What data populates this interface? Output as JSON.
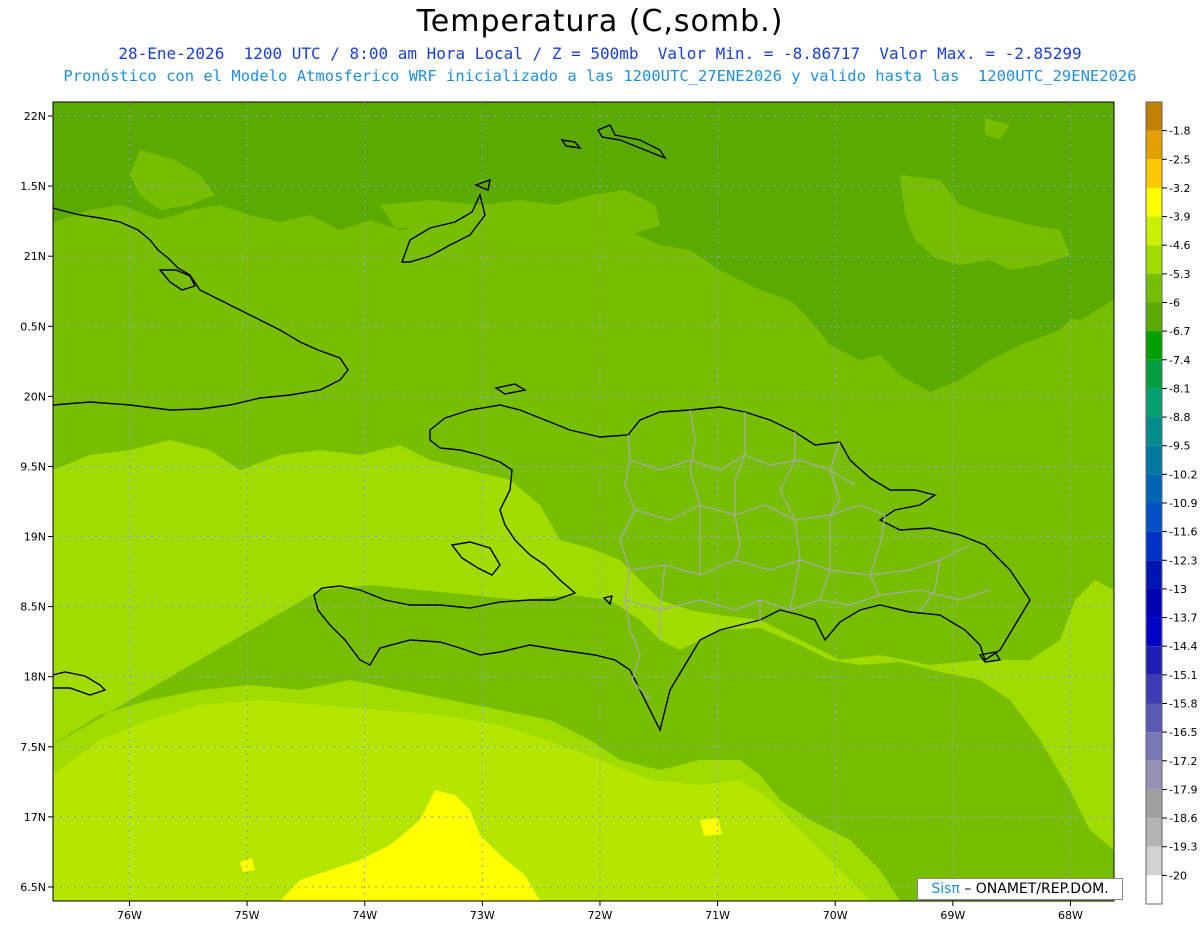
{
  "header": {
    "title": "Temperatura (C,somb.)",
    "line1": "28-Ene-2026  1200 UTC / 8:00 am Hora Local / Z = 500mb  Valor Min. = -8.86717  Valor Max. = -2.85299",
    "line2": "Pronóstico con el Modelo Atmosferico WRF inicializado a las 1200UTC_27ENE2026 y valido hasta las  1200UTC_29ENE2026"
  },
  "map": {
    "variable": "Temperatura",
    "units": "C",
    "level": "500mb",
    "valid_date": "28-Ene-2026",
    "valid_time": "1200 UTC",
    "local_time": "8:00 am Hora Local",
    "min_value": -8.86717,
    "max_value": -2.85299,
    "model": "WRF",
    "init": "1200UTC_27ENE2026",
    "valid_until": "1200UTC_29ENE2026",
    "extent": {
      "lon_min": -76.65,
      "lon_max": -67.63,
      "lat_min": 16.4,
      "lat_max": 22.1
    },
    "lat_labels": [
      "22N",
      "1.5N",
      "21N",
      "0.5N",
      "20N",
      "9.5N",
      "19N",
      "8.5N",
      "18N",
      "7.5N",
      "17N",
      "6.5N"
    ],
    "lat_values": [
      22,
      21.5,
      21,
      20.5,
      20,
      19.5,
      19,
      18.5,
      18,
      17.5,
      17,
      16.5
    ],
    "lon_labels": [
      "76W",
      "75W",
      "74W",
      "73W",
      "72W",
      "71W",
      "70W",
      "69W",
      "68W"
    ],
    "lon_values": [
      -76,
      -75,
      -74,
      -73,
      -72,
      -71,
      -70,
      -69,
      -68
    ],
    "grid": "dotted"
  },
  "colorbar": {
    "labels": [
      "-1.8",
      "-2.5",
      "-3.2",
      "-3.9",
      "-4.6",
      "-5.3",
      "-6",
      "-6.7",
      "-7.4",
      "-8.1",
      "-8.8",
      "-9.5",
      "-10.2",
      "-10.9",
      "-11.6",
      "-12.3",
      "-13",
      "-13.7",
      "-14.4",
      "-15.1",
      "-15.8",
      "-16.5",
      "-17.2",
      "-17.9",
      "-18.6",
      "-19.3",
      "-20"
    ],
    "colors": [
      "#c08000",
      "#e6a000",
      "#ffc800",
      "#ffff00",
      "#c8f000",
      "#a0dc00",
      "#78be00",
      "#5aaa00",
      "#00a000",
      "#00a040",
      "#00a070",
      "#008c8c",
      "#0078a0",
      "#0064b4",
      "#0050c8",
      "#0032c8",
      "#0014b4",
      "#0000b4",
      "#0000c8",
      "#1e1eb4",
      "#3c3cb4",
      "#5a5ab4",
      "#7878b4",
      "#9690b4",
      "#a0a0a0",
      "#b4b4b4",
      "#d2d2d2",
      "#ffffff"
    ]
  },
  "credit": {
    "logo": "Sisπ",
    "text": "– ONAMET/REP.DOM."
  }
}
